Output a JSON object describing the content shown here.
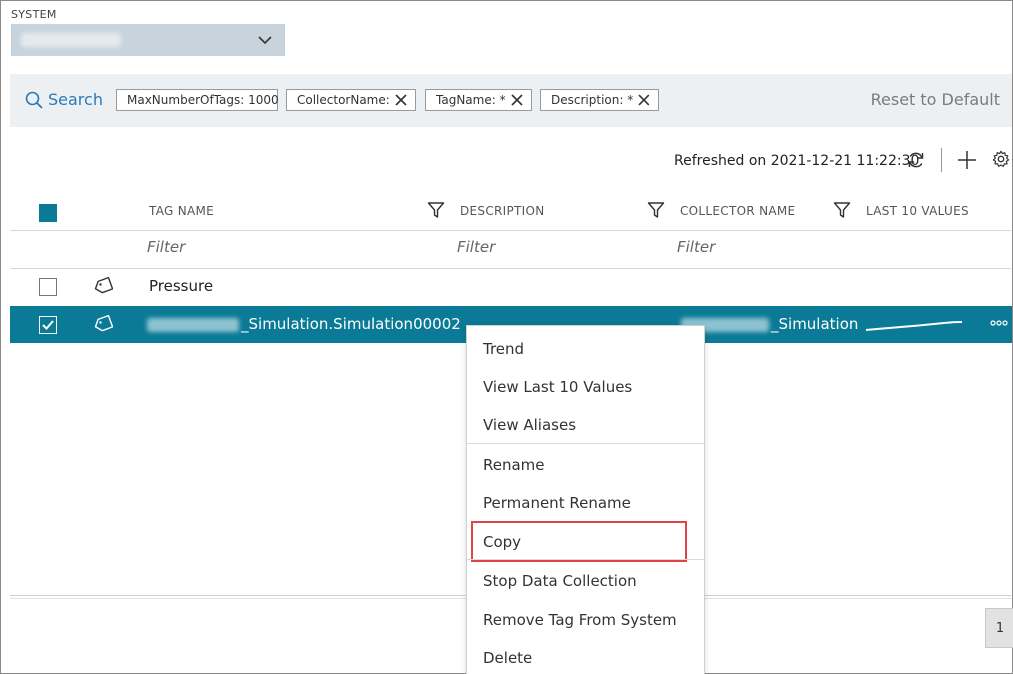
{
  "system": {
    "label": "SYSTEM",
    "selected_value": ""
  },
  "search": {
    "label": "Search",
    "chips": [
      {
        "label": "MaxNumberOfTags: 1000",
        "removable": false
      },
      {
        "label": "CollectorName:",
        "removable": true
      },
      {
        "label": "TagName: *",
        "removable": true
      },
      {
        "label": "Description: *",
        "removable": true
      }
    ],
    "reset_label": "Reset to Default"
  },
  "toolbar": {
    "refreshed_text": "Refreshed on 2021-12-21 11:22:30"
  },
  "table": {
    "columns": [
      "TAG NAME",
      "DESCRIPTION",
      "COLLECTOR NAME",
      "LAST 10 VALUES"
    ],
    "filter_placeholder": "Filter",
    "rows": [
      {
        "tag_name": "Pressure",
        "description": "",
        "collector_name": "",
        "checked": false
      },
      {
        "tag_name": "_Simulation.Simulation00002",
        "description": "",
        "collector_name": "_Simulation",
        "checked": true
      }
    ]
  },
  "context_menu": {
    "groups": [
      [
        "Trend",
        "View Last 10 Values",
        "View Aliases"
      ],
      [
        "Rename",
        "Permanent Rename",
        "Copy"
      ],
      [
        "Stop Data Collection",
        "Remove Tag From System",
        "Delete"
      ]
    ],
    "highlighted": "Copy"
  },
  "pagination": {
    "current_page": "1"
  },
  "colors": {
    "accent": "#0b7a96",
    "link": "#2a7ab8",
    "highlight": "#e0434a",
    "search_bar_bg": "#ecf0f3"
  }
}
